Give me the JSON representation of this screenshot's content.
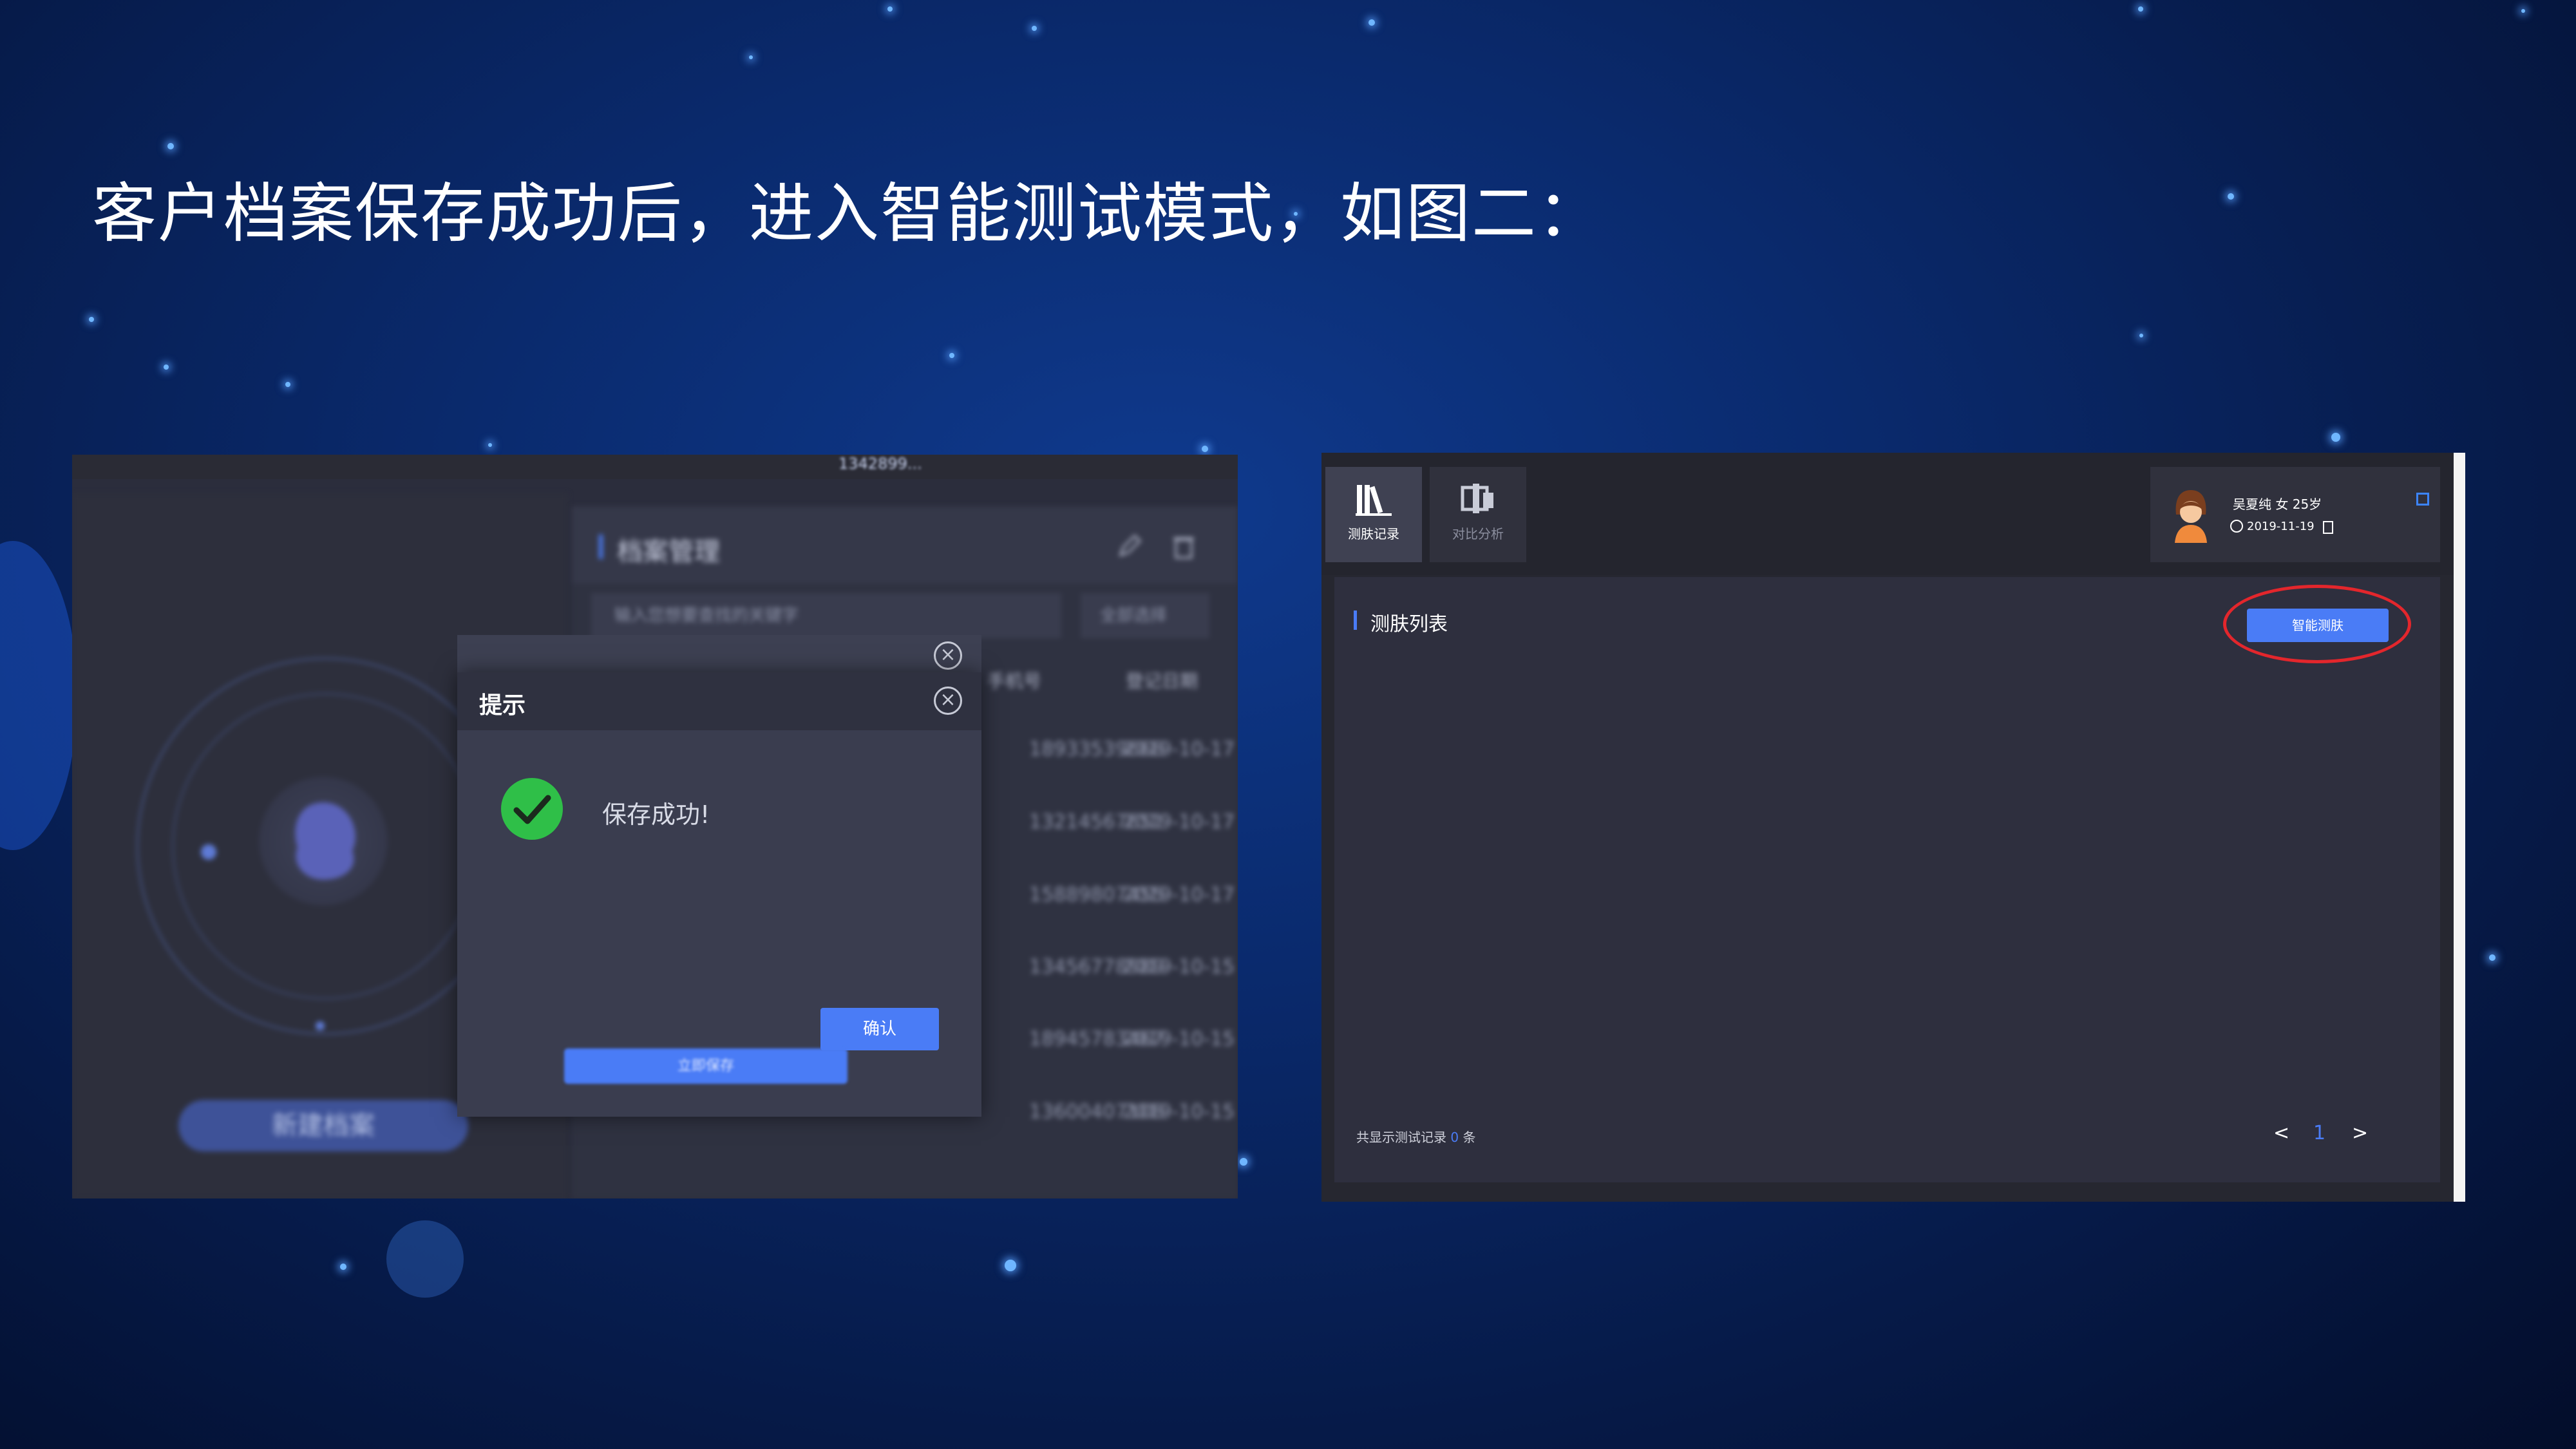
{
  "heading": "客户档案保存成功后，进入智能测试模式，如图二：",
  "left_screenshot": {
    "topbar_blurred_text": [
      "1342899..."
    ],
    "panel_title": "档案管理",
    "search_placeholder": "输入您想要查找的关键字",
    "filter_label": "全部选择",
    "columns": [
      "手机号",
      "登记日期"
    ],
    "rows": [
      {
        "phone": "18933539668",
        "date": "2019-10-17"
      },
      {
        "phone": "13214567651",
        "date": "2019-10-17"
      },
      {
        "phone": "15889807455",
        "date": "2019-10-17"
      },
      {
        "phone": "13456778989",
        "date": "2019-10-15"
      },
      {
        "phone": "18945783467",
        "date": "2019-10-15"
      },
      {
        "phone": "13600407108",
        "date": "2019-10-15"
      }
    ],
    "new_profile_button": "新建档案",
    "save_now_button": "立即保存",
    "dialog": {
      "title": "提示",
      "message": "保存成功!",
      "confirm_button": "确认"
    }
  },
  "right_screenshot": {
    "tabs": [
      {
        "label": "测肤记录",
        "icon": "books-icon",
        "active": true
      },
      {
        "label": "对比分析",
        "icon": "compare-icon",
        "active": false
      }
    ],
    "profile": {
      "name_line": "吴夏纯  女  25岁",
      "date": "2019-11-19"
    },
    "section_title": "测肤列表",
    "smart_test_button": "智能测肤",
    "footer": {
      "prefix": "共显示测试记录",
      "count": "0",
      "suffix": "条"
    },
    "pagination": {
      "prev": "<",
      "current": "1",
      "next": ">"
    },
    "highlight_color": "#e3262c",
    "accent_color": "#4a7cf6"
  }
}
